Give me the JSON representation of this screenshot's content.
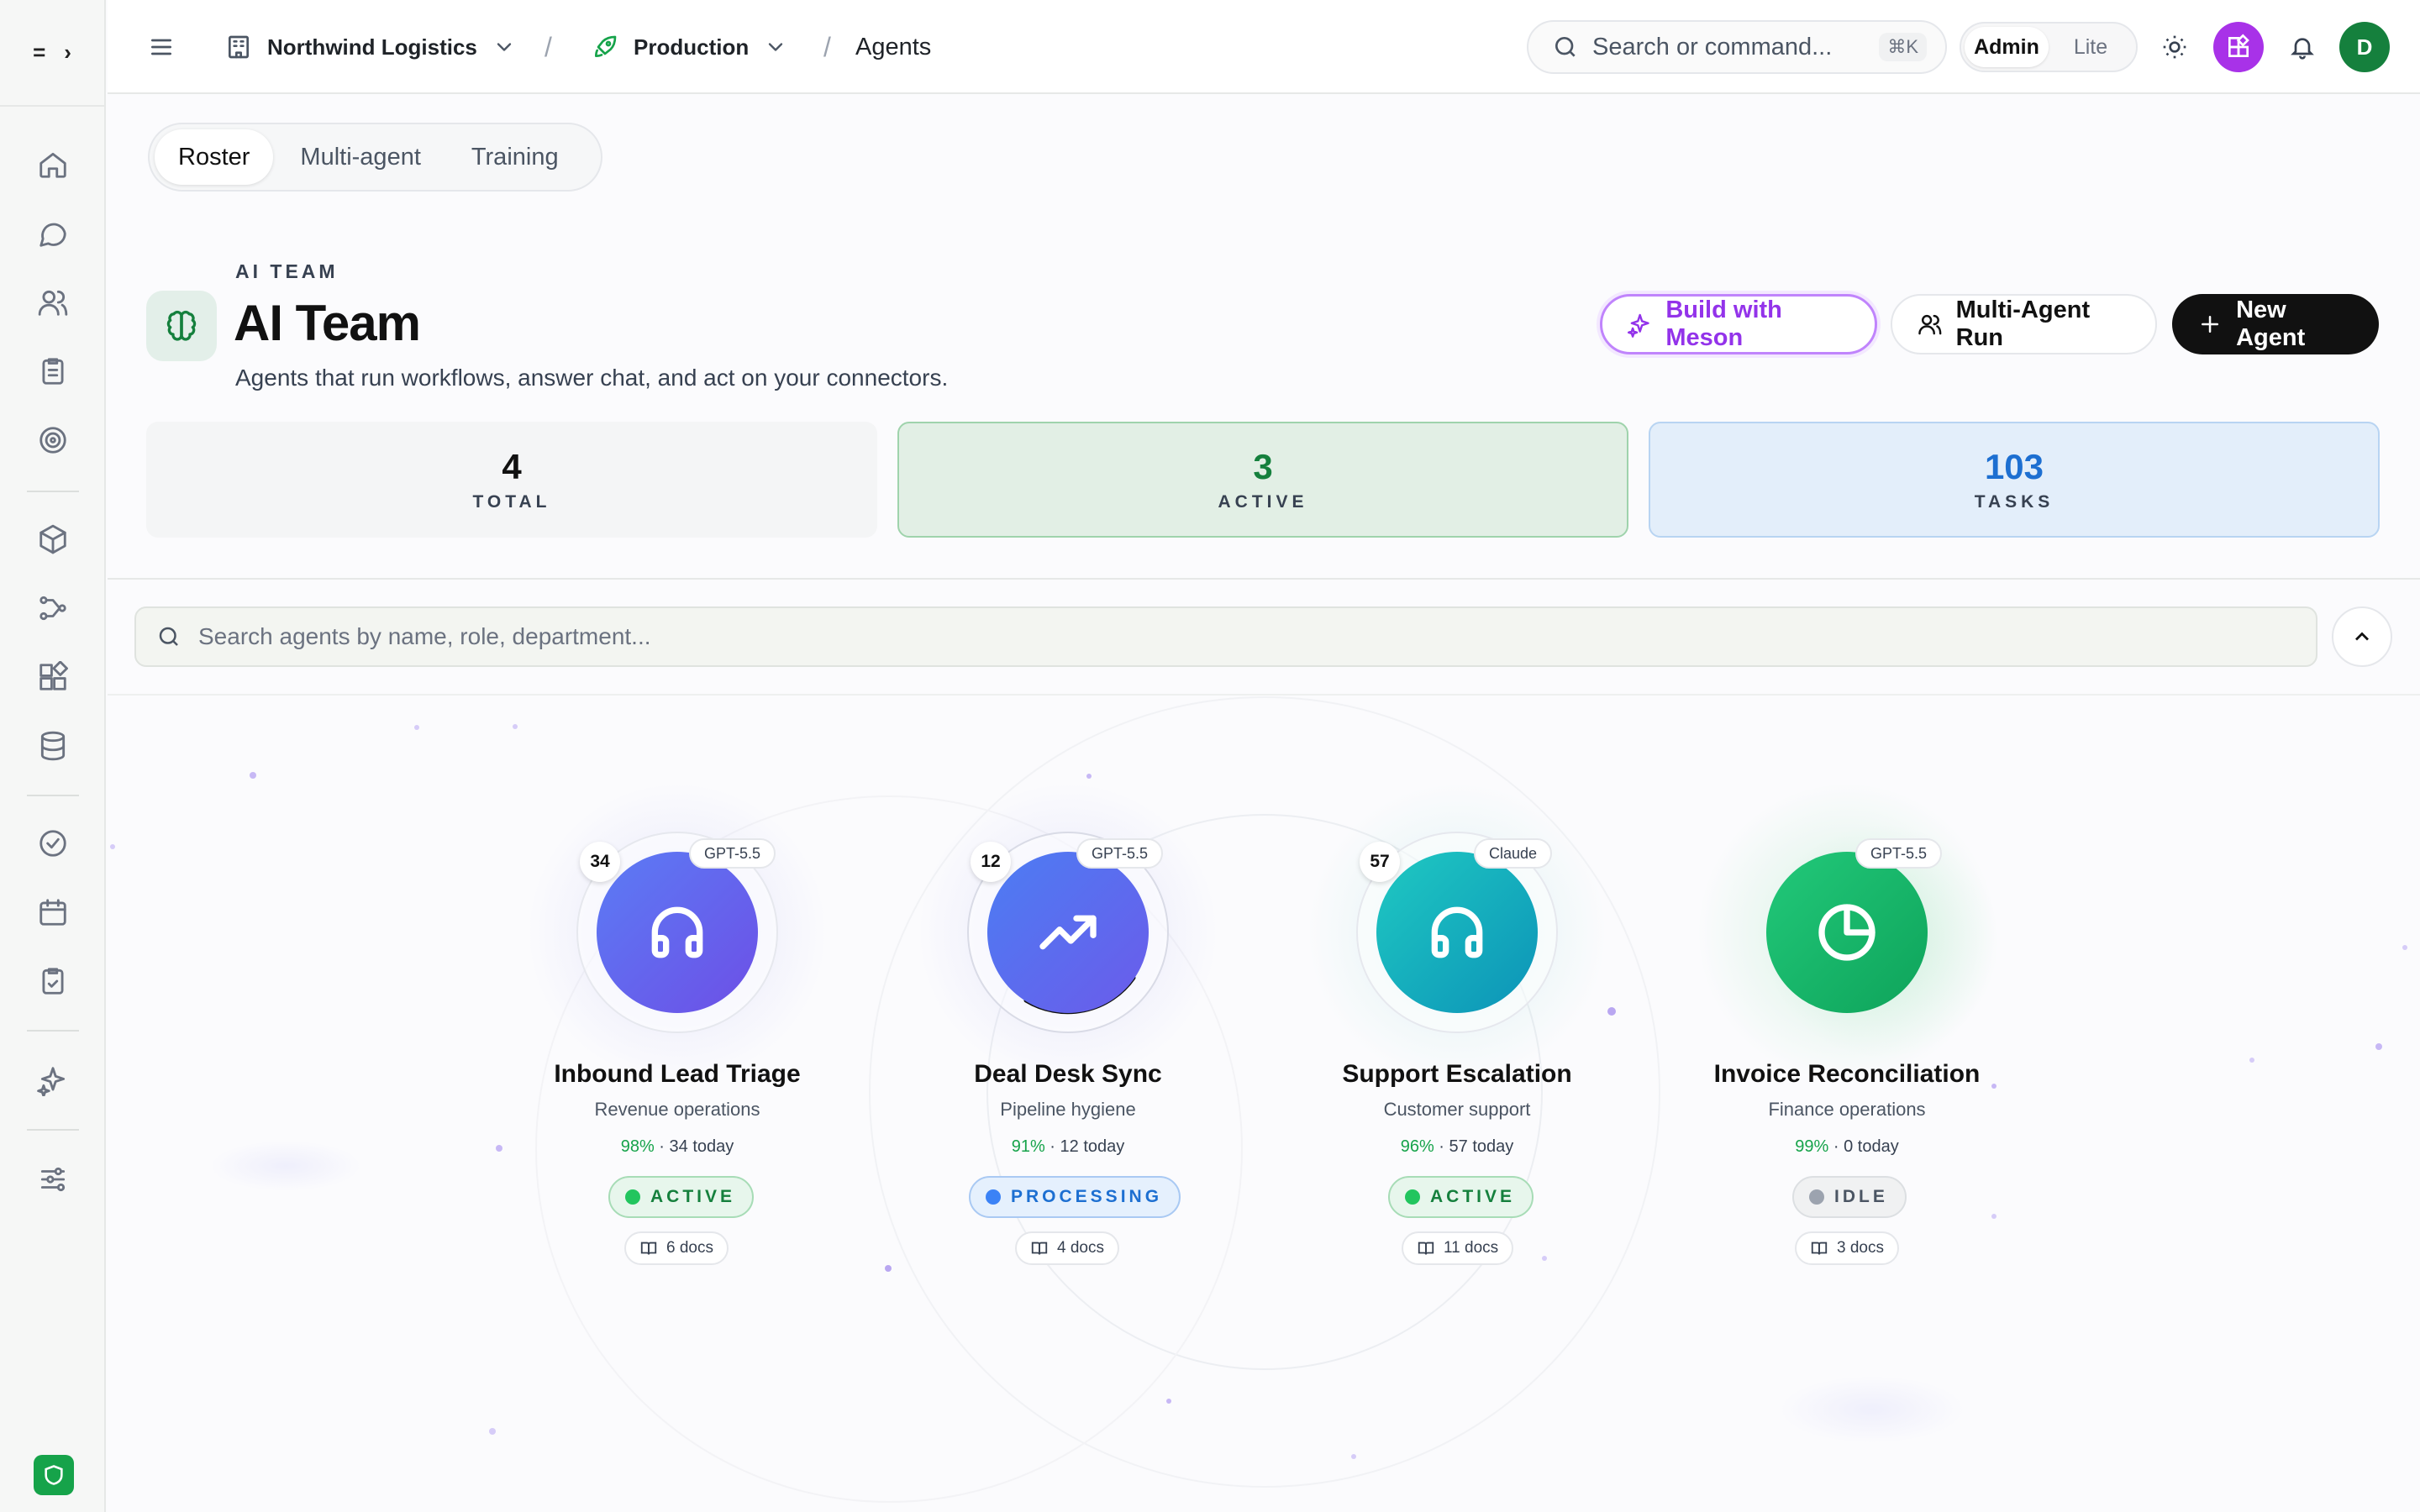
{
  "header": {
    "org": "Northwind Logistics",
    "env": "Production",
    "page": "Agents",
    "search_placeholder": "Search or command...",
    "shortcut": "⌘K",
    "mode_admin": "Admin",
    "mode_lite": "Lite",
    "avatar_initial": "D"
  },
  "tabs": [
    "Roster",
    "Multi-agent",
    "Training"
  ],
  "title": {
    "eyebrow": "AI TEAM",
    "heading": "AI Team",
    "subtitle": "Agents that run workflows, answer chat, and act on your connectors."
  },
  "actions": {
    "meson": "Build with Meson",
    "multi": "Multi-Agent Run",
    "new": "New Agent"
  },
  "stats": {
    "total": {
      "value": "4",
      "label": "TOTAL"
    },
    "active": {
      "value": "3",
      "label": "ACTIVE"
    },
    "tasks": {
      "value": "103",
      "label": "TASKS"
    }
  },
  "agent_search_placeholder": "Search agents by name, role, department...",
  "agents": [
    {
      "name": "Inbound Lead Triage",
      "role": "Revenue operations",
      "rate": "98%",
      "today": " · 34 today",
      "count": "34",
      "model": "GPT-5.5",
      "status": "ACTIVE",
      "docs": "6 docs",
      "icon": "headphones-icon"
    },
    {
      "name": "Deal Desk Sync",
      "role": "Pipeline hygiene",
      "rate": "91%",
      "today": " · 12 today",
      "count": "12",
      "model": "GPT-5.5",
      "status": "PROCESSING",
      "docs": "4 docs",
      "icon": "trending-up-icon"
    },
    {
      "name": "Support Escalation",
      "role": "Customer support",
      "rate": "96%",
      "today": " · 57 today",
      "count": "57",
      "model": "Claude",
      "status": "ACTIVE",
      "docs": "11 docs",
      "icon": "headphones-icon"
    },
    {
      "name": "Invoice Reconciliation",
      "role": "Finance operations",
      "rate": "99%",
      "today": " · 0 today",
      "count": "",
      "model": "GPT-5.5",
      "status": "IDLE",
      "docs": "3 docs",
      "icon": "pie-chart-icon"
    }
  ],
  "colors": {
    "active": "#16a34a",
    "processing": "#3b82f6",
    "idle": "#9ca3af",
    "brand": "#9333ea"
  }
}
